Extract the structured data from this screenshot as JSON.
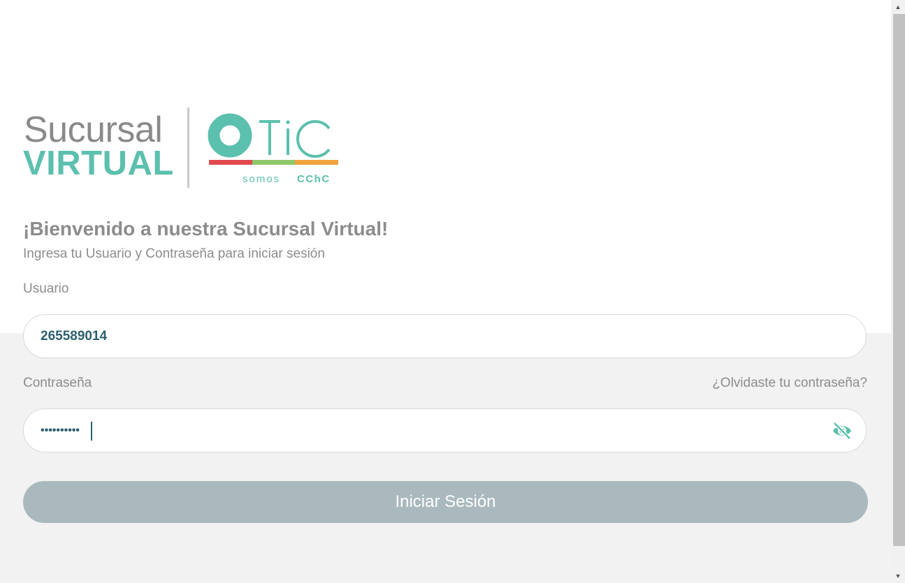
{
  "brand": {
    "line1": "Sucursal",
    "line2": "VIRTUAL",
    "otic_text": "OTiC",
    "tagline_prefix": "somos",
    "tagline_bold": "CChC",
    "colors": {
      "teal": "#5cc0ae",
      "gray": "#8a8a8a",
      "bar_red": "#e04a4f",
      "bar_green": "#8ec86b",
      "bar_orange": "#f0a33e"
    }
  },
  "welcome": {
    "title": "¡Bienvenido a nuestra Sucursal Virtual!",
    "subtitle": "Ingresa tu Usuario y Contraseña para iniciar sesión"
  },
  "form": {
    "user_label": "Usuario",
    "user_value": "265589014",
    "password_label": "Contraseña",
    "password_value": "••••••••••",
    "forgot_link": "¿Olvidaste tu contraseña?",
    "toggle_visibility_icon": "eye-off-icon",
    "submit_label": "Iniciar Sesión"
  },
  "scrollbar": {
    "up_icon": "▲",
    "down_icon": "▼"
  }
}
